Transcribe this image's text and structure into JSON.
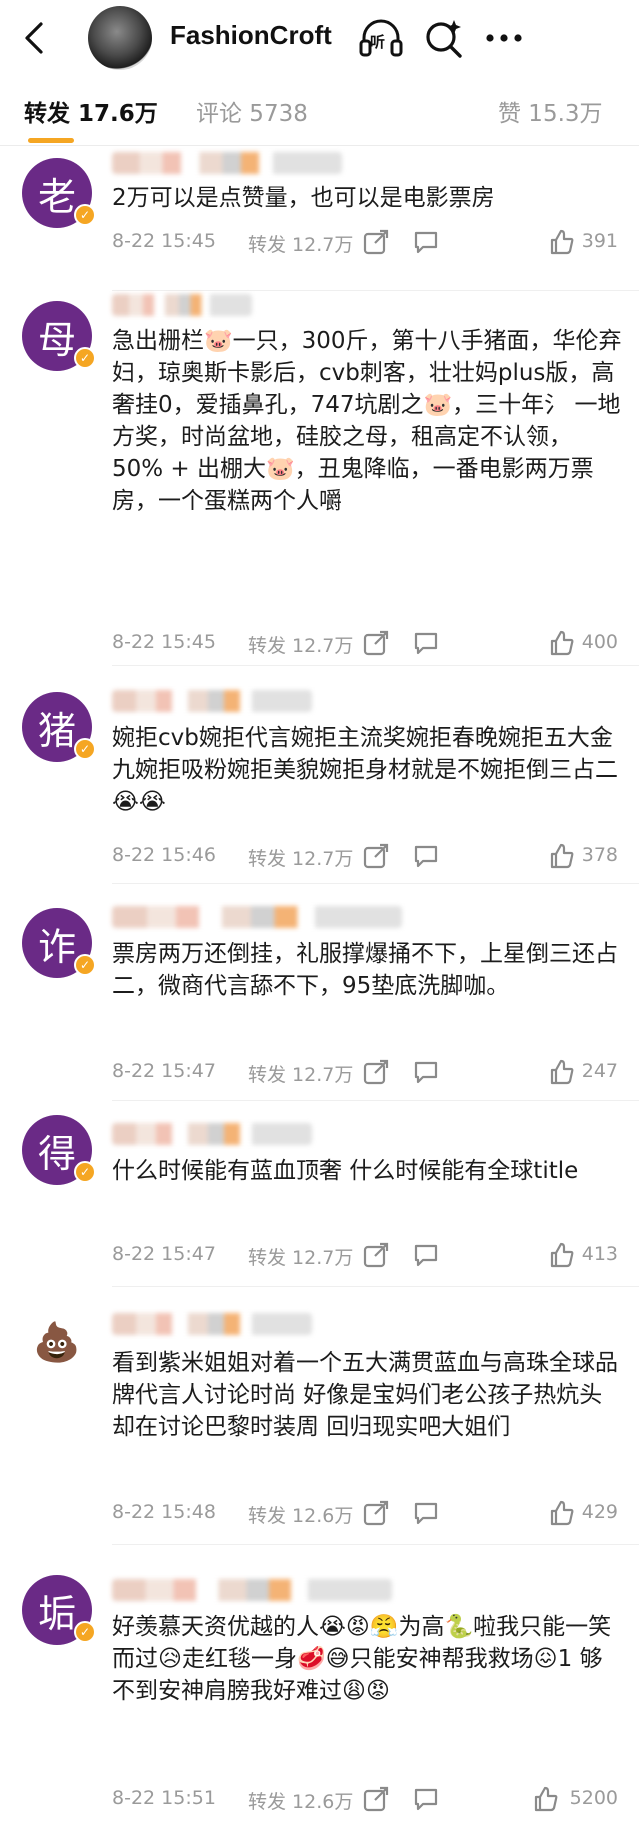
{
  "header": {
    "back_icon": "back-arrow-icon",
    "title": "FashionCroft",
    "listen_icon": "headphones-icon",
    "listen_label": "听",
    "search_icon": "search-sparkle-icon",
    "more_icon": "more-dots-icon"
  },
  "tabs": {
    "repost": "转发 17.6万",
    "comment": "评论 5738",
    "like": "赞 15.3万",
    "accent": "#f5a623"
  },
  "comments": [
    {
      "avatar": "老",
      "text": "2万可以是点赞量，也可以是电影票房",
      "time": "8-22 15:45",
      "repost": "转发 12.7万",
      "likes": "391"
    },
    {
      "avatar": "母",
      "text": "急出栅栏🐷一只，300斤，第十八手猪面，华伦弃妇，琼奥斯卡影后，cvb刺客，壮壮妈plus版，高奢挂0，爱插鼻孔，747坑剧之🐷，三十年氵 一地方奖，时尚盆地，硅胶之母，租高定不认领，50% + 出棚大🐷，丑鬼降临，一番电影两万票房，一个蛋糕两个人嚼",
      "time": "8-22 15:45",
      "repost": "转发 12.7万",
      "likes": "400"
    },
    {
      "avatar": "猪",
      "text": "婉拒cvb婉拒代言婉拒主流奖婉拒春晚婉拒五大金九婉拒吸粉婉拒美貌婉拒身材就是不婉拒倒三占二😭😭",
      "time": "8-22 15:46",
      "repost": "转发 12.7万",
      "likes": "378"
    },
    {
      "avatar": "诈",
      "text": "票房两万还倒挂，礼服撑爆捅不下，上星倒三还占二，微商代言舔不下，95垫底洗脚咖。",
      "time": "8-22 15:47",
      "repost": "转发 12.7万",
      "likes": "247"
    },
    {
      "avatar": "得",
      "text": "什么时候能有蓝血顶奢 什么时候能有全球title",
      "time": "8-22 15:47",
      "repost": "转发 12.7万",
      "likes": "413"
    },
    {
      "avatar": "💩",
      "text": "看到紫米姐姐对着一个五大满贯蓝血与高珠全球品牌代言人讨论时尚 好像是宝妈们老公孩子热炕头却在讨论巴黎时装周 回归现实吧大姐们",
      "time": "8-22 15:48",
      "repost": "转发 12.6万",
      "likes": "429"
    },
    {
      "avatar": "垢",
      "text": "好羡慕天资优越的人😭😡😤为高🐍啦我只能一笑而过😥走红毯一身🥩😅只能安神帮我救场😖1  够不到安神肩膀我好难过😩😡",
      "time": "8-22 15:51",
      "repost": "转发 12.6万",
      "likes": "5200"
    }
  ],
  "icons": {
    "share": "share-icon",
    "comment": "comment-icon",
    "like": "thumbs-up-icon",
    "verified": "verified-badge-icon",
    "avatar_color": "#6a2a86"
  }
}
